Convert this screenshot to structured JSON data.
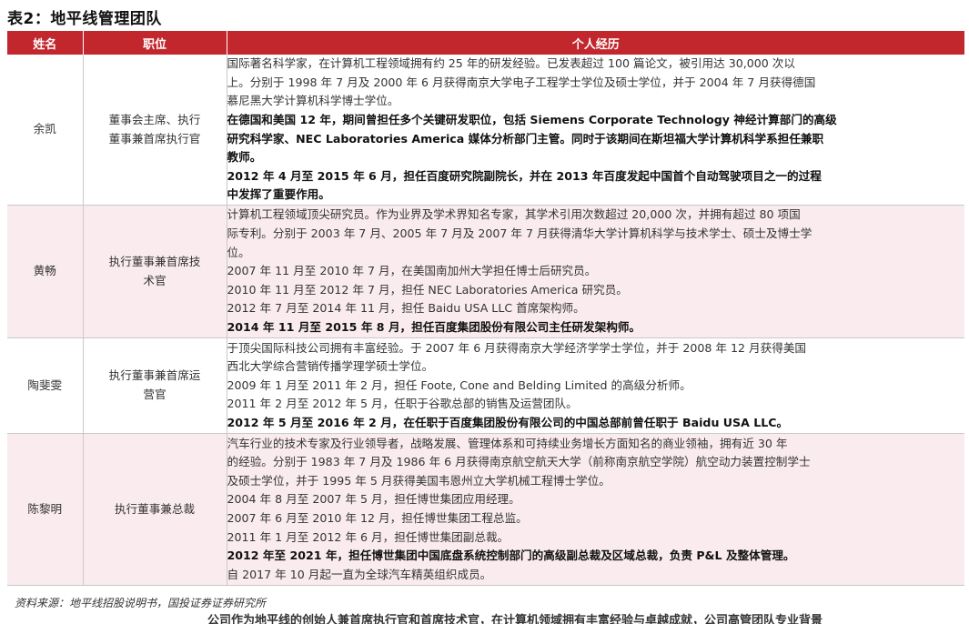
{
  "title": "表2：地平线管理团队",
  "table": {
    "headers": [
      "姓名",
      "职位",
      "个人经历"
    ],
    "rows": [
      {
        "name": "余凯",
        "position_lines": [
          "董事会主席、执行",
          "董事兼首席执行官"
        ],
        "paragraphs": [
          {
            "bold": false,
            "lines": [
              "国际著名科学家，在计算机工程领域拥有约 25 年的研发经验。已发表超过 100 篇论文，被引用达 30,000 次以",
              "上。分别于 1998 年 7 月及 2000 年 6 月获得南京大学电子工程学士学位及硕士学位，并于 2004 年 7 月获得德国",
              "慕尼黑大学计算机科学博士学位。"
            ]
          },
          {
            "bold": true,
            "lines": [
              "在德国和美国 12 年，期间曾担任多个关键研发职位，包括 Siemens Corporate Technology 神经计算部门的高级",
              "研究科学家、NEC Laboratories America 媒体分析部门主管。同时于该期间在斯坦福大学计算机科学系担任兼职",
              "教师。"
            ]
          },
          {
            "bold": true,
            "lines": [
              "2012 年 4 月至 2015 年 6 月，担任百度研究院副院长，并在 2013 年百度发起中国首个自动驾驶项目之一的过程",
              "中发挥了重要作用。"
            ]
          }
        ]
      },
      {
        "name": "黄畅",
        "position_lines": [
          "执行董事兼首席技",
          "术官"
        ],
        "paragraphs": [
          {
            "bold": false,
            "lines": [
              "计算机工程领域顶尖研究员。作为业界及学术界知名专家，其学术引用次数超过 20,000 次，并拥有超过 80 项国",
              "际专利。分别于 2003 年 7 月、2005 年 7 月及 2007 年 7 月获得清华大学计算机科学与技术学士、硕士及博士学",
              "位。"
            ]
          },
          {
            "bold": false,
            "lines": [
              "2007 年 11 月至 2010 年 7 月，在美国南加州大学担任博士后研究员。"
            ]
          },
          {
            "bold": false,
            "lines": [
              "2010 年 11 月至 2012 年 7 月，担任 NEC Laboratories America 研究员。"
            ]
          },
          {
            "bold": false,
            "lines": [
              "2012 年 7 月至 2014 年 11 月，担任 Baidu USA LLC 首席架构师。"
            ]
          },
          {
            "bold": true,
            "lines": [
              "2014 年 11 月至 2015 年 8 月，担任百度集团股份有限公司主任研发架构师。"
            ]
          }
        ]
      },
      {
        "name": "陶斐雯",
        "position_lines": [
          "执行董事兼首席运",
          "营官"
        ],
        "paragraphs": [
          {
            "bold": false,
            "lines": [
              "于顶尖国际科技公司拥有丰富经验。于 2007 年 6 月获得南京大学经济学学士学位，并于 2008 年 12 月获得美国",
              "西北大学综合营销传播学理学硕士学位。"
            ]
          },
          {
            "bold": false,
            "lines": [
              "2009 年 1 月至 2011 年 2 月，担任 Foote, Cone and Belding Limited 的高级分析师。"
            ]
          },
          {
            "bold": false,
            "lines": [
              "2011 年 2 月至 2012 年 5 月，任职于谷歌总部的销售及运营团队。"
            ]
          },
          {
            "bold": true,
            "lines": [
              "2012 年 5 月至 2016 年 2 月，在任职于百度集团股份有限公司的中国总部前曾任职于 Baidu USA LLC。"
            ]
          }
        ]
      },
      {
        "name": "陈黎明",
        "position_lines": [
          "执行董事兼总裁"
        ],
        "paragraphs": [
          {
            "bold": false,
            "lines": [
              "汽车行业的技术专家及行业领导者，战略发展、管理体系和可持续业务增长方面知名的商业领袖，拥有近 30 年",
              "的经验。分别于 1983 年 7 月及 1986 年 6 月获得南京航空航天大学（前称南京航空学院）航空动力装置控制学士",
              "及硕士学位，并于 1995 年 5 月获得美国韦恩州立大学机械工程博士学位。"
            ]
          },
          {
            "bold": false,
            "lines": [
              "2004 年 8 月至 2007 年 5 月，担任博世集团应用经理。"
            ]
          },
          {
            "bold": false,
            "lines": [
              "2007 年 6 月至 2010 年 12 月，担任博世集团工程总监。"
            ]
          },
          {
            "bold": false,
            "lines": [
              "2011 年 1 月至 2012 年 6 月，担任博世集团副总裁。"
            ]
          },
          {
            "bold": true,
            "lines": [
              "2012 年至 2021 年，担任博世集团中国底盘系统控制部门的高级副总裁及区域总裁，负责 P&L 及整体管理。"
            ]
          },
          {
            "bold": false,
            "lines": [
              "自 2017 年 10 月起一直为全球汽车精英组织成员。"
            ]
          }
        ]
      }
    ]
  },
  "source": "资料来源：地平线招股说明书，国投证券证券研究所",
  "bottom_fragment": "公司作为地平线的创始人兼首席执行官和首席技术官，在计算机领域拥有丰富经验与卓越成就，公司高管团队专业背景"
}
